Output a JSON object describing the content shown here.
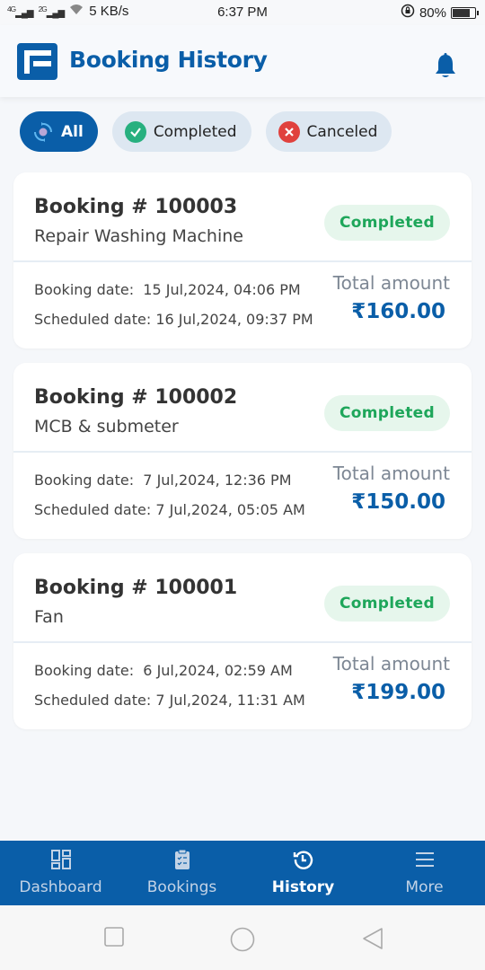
{
  "status_bar": {
    "network_1": "4G",
    "network_2": "2G",
    "speed": "5 KB/s",
    "time": "6:37 PM",
    "battery": "80%",
    "battery_level": 0.8
  },
  "header": {
    "title": "Booking History",
    "logo_icon": "app-logo",
    "notification_icon": "bell-icon"
  },
  "filters": [
    {
      "label": "All",
      "icon": "sync-icon",
      "active": true
    },
    {
      "label": "Completed",
      "icon": "check-circle-icon",
      "active": false
    },
    {
      "label": "Canceled",
      "icon": "close-circle-icon",
      "active": false
    }
  ],
  "bookings": [
    {
      "number": "Booking # 100003",
      "service": "Repair Washing Machine",
      "status": "Completed",
      "booking_date_label": "Booking date:",
      "booking_date": "15 Jul,2024, 04:06 PM",
      "scheduled_date_label": "Scheduled date:",
      "scheduled_date": "16 Jul,2024, 09:37 PM",
      "total_label": "Total amount",
      "total": "₹160.00"
    },
    {
      "number": "Booking # 100002",
      "service": "MCB & submeter",
      "status": "Completed",
      "booking_date_label": "Booking date:",
      "booking_date": "7 Jul,2024, 12:36 PM",
      "scheduled_date_label": "Scheduled date:",
      "scheduled_date": "7 Jul,2024, 05:05 AM",
      "total_label": "Total amount",
      "total": "₹150.00"
    },
    {
      "number": "Booking # 100001",
      "service": "Fan",
      "status": "Completed",
      "booking_date_label": "Booking date:",
      "booking_date": "6 Jul,2024, 02:59 AM",
      "scheduled_date_label": "Scheduled date:",
      "scheduled_date": "7 Jul,2024, 11:31 AM",
      "total_label": "Total amount",
      "total": "₹199.00"
    }
  ],
  "bottom_nav": [
    {
      "label": "Dashboard",
      "icon": "dashboard-icon",
      "active": false
    },
    {
      "label": "Bookings",
      "icon": "clipboard-icon",
      "active": false
    },
    {
      "label": "History",
      "icon": "history-icon",
      "active": true
    },
    {
      "label": "More",
      "icon": "menu-icon",
      "active": false
    }
  ],
  "colors": {
    "primary": "#0a5ea8",
    "completed_text": "#1ea65a",
    "completed_bg": "#e6f6ec",
    "cancel_red": "#e0413d",
    "check_green": "#27b07f"
  }
}
